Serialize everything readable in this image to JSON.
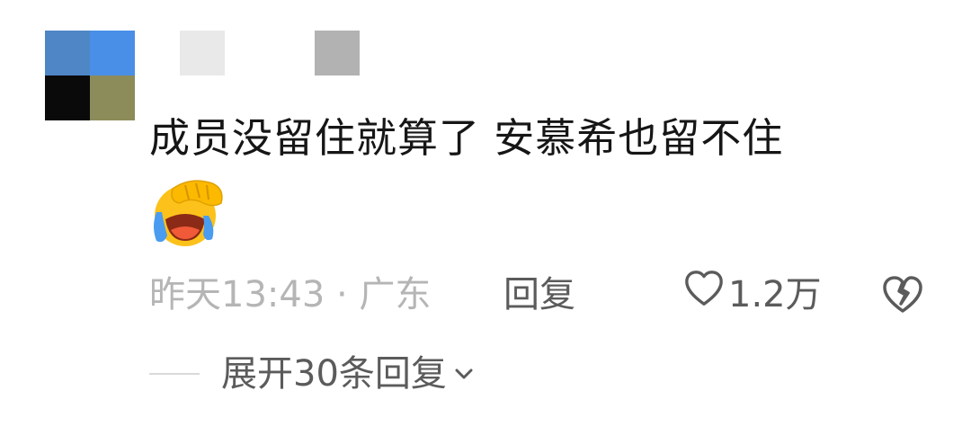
{
  "comment": {
    "avatar_colors": [
      "#4f86c6",
      "#4a8fe7",
      "#0a0a0a",
      "#8c8c5a"
    ],
    "username_colors": [
      "#e9e9e9",
      "#b2b2b2"
    ],
    "text": "成员没留住就算了 安慕希也留不住",
    "emoji_icon": "facepalm-crying-emoji",
    "meta": {
      "time_location": "昨天13:43 · 广东",
      "reply_label": "回复",
      "like_count": "1.2万"
    },
    "expand": {
      "label": "展开30条回复"
    }
  }
}
